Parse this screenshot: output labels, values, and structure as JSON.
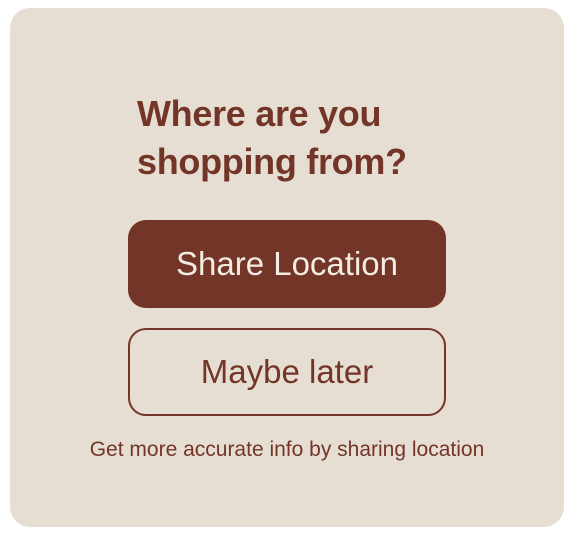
{
  "dialog": {
    "title_line1": "Where are you",
    "title_line2": "shopping from?",
    "share_label": "Share Location",
    "later_label": "Maybe later",
    "helper_text": "Get more accurate info by sharing location"
  },
  "colors": {
    "background": "#e6ded2",
    "accent": "#733528",
    "button_text": "#f3ece3"
  }
}
